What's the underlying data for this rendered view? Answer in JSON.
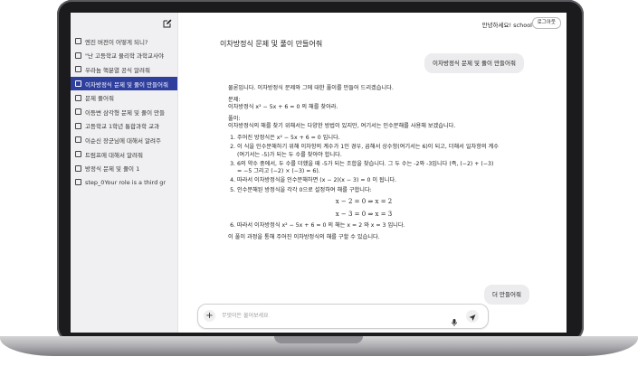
{
  "sidebar": {
    "items": [
      {
        "label": "엔진 버전이 어떻게 되니?"
      },
      {
        "label": "\"난 고등학교 물리학 과학교사야"
      },
      {
        "label": "우라늄 핵분열 공식 알려줘"
      },
      {
        "label": "이차방정식 문제 및 풀이 만들어줘",
        "active": true
      },
      {
        "label": "문제 풀어줘"
      },
      {
        "label": "이등변 삼각형 문제 및 풀이 만들"
      },
      {
        "label": "고등학교 1학년 통합과학 교과"
      },
      {
        "label": "이순신 장군님에 대해서 알려주"
      },
      {
        "label": "트럼프에 대해서 알려줘"
      },
      {
        "label": "방정식 문제 및 풀이 1"
      },
      {
        "label": "step_0Your role is a third gr"
      }
    ]
  },
  "header": {
    "greeting": "안녕하세요!  school",
    "logout_label": "로그아웃"
  },
  "chat": {
    "title": "이차방정식 문제 및 풀이 만들어줘",
    "user_message_1": "이차방정식 문제 및 풀이 만들어줘",
    "intro": "물론입니다. 이차방정식 문제와 그에 대한 풀이를 만들어 드리겠습니다.",
    "problem_label": "문제:",
    "problem_text": "이차방정식 x² − 5x + 6 = 0 의 해를 찾아라.",
    "solution_label": "풀이:",
    "solution_intro": "이차방정식의 해를 찾기 위해서는 다양한 방법이 있지만, 여기서는 인수분해를 사용해 보겠습니다.",
    "steps": [
      "주어진 방정식은 x² − 5x + 6 = 0 입니다.",
      "이 식을 인수분해하기 위해 이차항의 계수가 1인 경우, 곱해서 상수항(여기서는 6)이 되고, 더해서 일차항의 계수(여기서는 -5)가 되는 두 수를 찾아야 합니다.",
      "6의 약수 중에서, 두 수를 더했을 때 -5가 되는 조합을 찾습니다. 그 두 수는 -2와 -3입니다 (즉, (−2) + (−3) = −5 그리고 (−2) × (−3) = 6).",
      "따라서 이차방정식을 인수분해하면 (x − 2)(x − 3) = 0 이 됩니다.",
      "인수분해된 방정식을 각각 0으로 설정하여 해를 구합니다:"
    ],
    "equation_1": "x − 2 = 0 ⇒ x = 2",
    "equation_2": "x − 3 = 0 ⇒ x = 3",
    "step_6": "따라서 이차방정식 x² − 5x + 6 = 0 의 해는 x = 2 와 x = 3 입니다.",
    "conclusion": "이 풀이 과정을 통해 주어진 이차방정식의 해를 구할 수 있습니다.",
    "user_message_2": "더 만들어줘"
  },
  "composer": {
    "placeholder": "무엇이든 물어보세요",
    "plus_label": "+"
  },
  "icons": {
    "new_chat": "edit-icon",
    "mic": "mic-icon",
    "send": "send-icon"
  }
}
